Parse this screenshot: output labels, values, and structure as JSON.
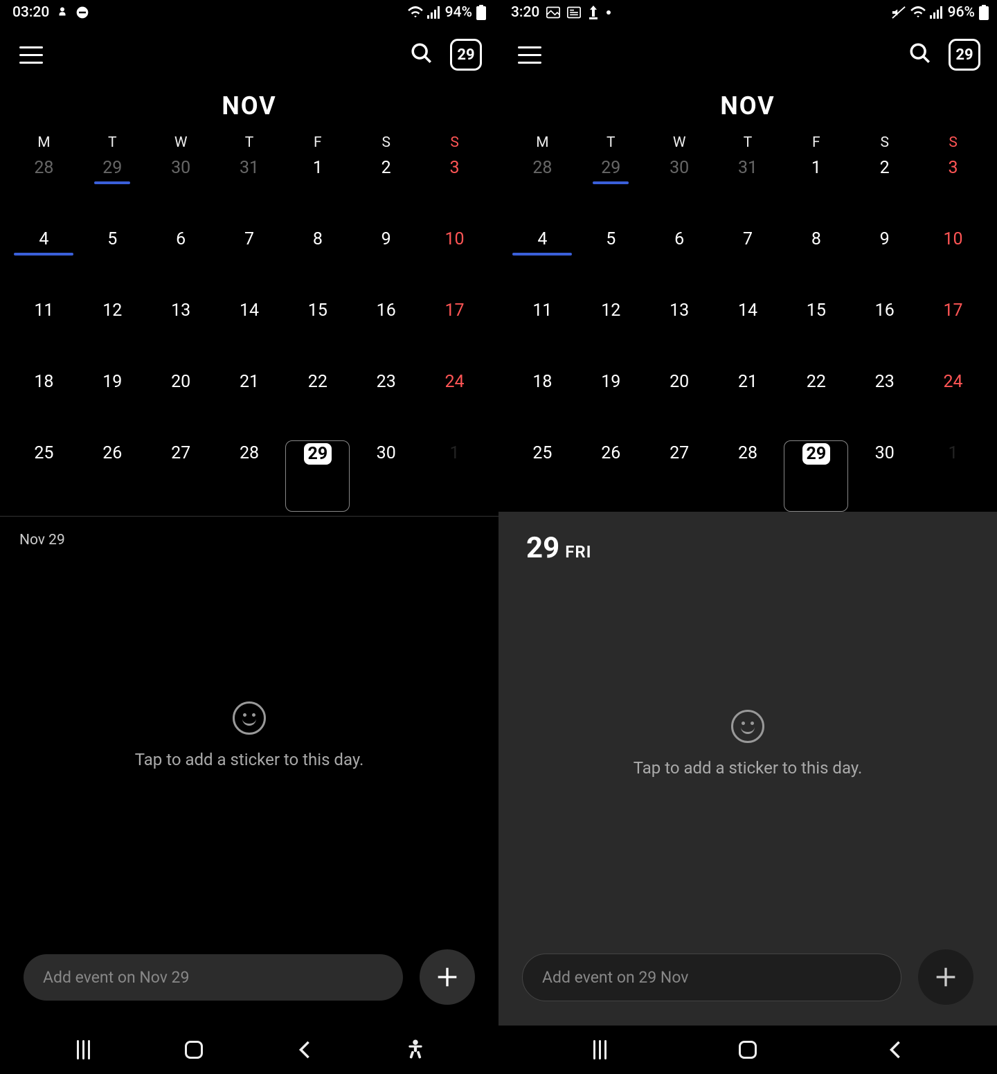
{
  "left": {
    "status": {
      "time": "03:20",
      "battery": "94%"
    },
    "appbar": {
      "today_badge": "29"
    },
    "month": "NOV",
    "weekdays": [
      "M",
      "T",
      "W",
      "T",
      "F",
      "S",
      "S"
    ],
    "rows": [
      [
        {
          "d": "28",
          "cls": "other-month"
        },
        {
          "d": "29",
          "cls": "other-month",
          "underline": true
        },
        {
          "d": "30",
          "cls": "other-month"
        },
        {
          "d": "31",
          "cls": "other-month"
        },
        {
          "d": "1"
        },
        {
          "d": "2"
        },
        {
          "d": "3",
          "cls": "sunday"
        }
      ],
      [
        {
          "d": "4",
          "underline": true,
          "underlineWide": true
        },
        {
          "d": "5"
        },
        {
          "d": "6"
        },
        {
          "d": "7"
        },
        {
          "d": "8"
        },
        {
          "d": "9"
        },
        {
          "d": "10",
          "cls": "sunday"
        }
      ],
      [
        {
          "d": "11"
        },
        {
          "d": "12"
        },
        {
          "d": "13"
        },
        {
          "d": "14"
        },
        {
          "d": "15"
        },
        {
          "d": "16"
        },
        {
          "d": "17",
          "cls": "sunday"
        }
      ],
      [
        {
          "d": "18"
        },
        {
          "d": "19"
        },
        {
          "d": "20"
        },
        {
          "d": "21"
        },
        {
          "d": "22"
        },
        {
          "d": "23"
        },
        {
          "d": "24",
          "cls": "sunday"
        }
      ],
      [
        {
          "d": "25"
        },
        {
          "d": "26"
        },
        {
          "d": "27"
        },
        {
          "d": "28"
        },
        {
          "d": "29",
          "today": true,
          "selected": true
        },
        {
          "d": "30"
        },
        {
          "d": "1",
          "cls": "dim-next"
        }
      ]
    ],
    "panel": {
      "date_small": "Nov 29",
      "sticker_hint": "Tap to add a sticker to this day.",
      "input_placeholder": "Add event on Nov 29"
    }
  },
  "right": {
    "status": {
      "time": "3:20",
      "battery": "96%"
    },
    "appbar": {
      "today_badge": "29"
    },
    "month": "NOV",
    "weekdays": [
      "M",
      "T",
      "W",
      "T",
      "F",
      "S",
      "S"
    ],
    "rows": [
      [
        {
          "d": "28",
          "cls": "other-month"
        },
        {
          "d": "29",
          "cls": "other-month",
          "underline": true
        },
        {
          "d": "30",
          "cls": "other-month"
        },
        {
          "d": "31",
          "cls": "other-month"
        },
        {
          "d": "1"
        },
        {
          "d": "2"
        },
        {
          "d": "3",
          "cls": "sunday"
        }
      ],
      [
        {
          "d": "4",
          "underline": true,
          "underlineWide": true
        },
        {
          "d": "5"
        },
        {
          "d": "6"
        },
        {
          "d": "7"
        },
        {
          "d": "8"
        },
        {
          "d": "9"
        },
        {
          "d": "10",
          "cls": "sunday"
        }
      ],
      [
        {
          "d": "11"
        },
        {
          "d": "12"
        },
        {
          "d": "13"
        },
        {
          "d": "14"
        },
        {
          "d": "15"
        },
        {
          "d": "16"
        },
        {
          "d": "17",
          "cls": "sunday"
        }
      ],
      [
        {
          "d": "18"
        },
        {
          "d": "19"
        },
        {
          "d": "20"
        },
        {
          "d": "21"
        },
        {
          "d": "22"
        },
        {
          "d": "23"
        },
        {
          "d": "24",
          "cls": "sunday"
        }
      ],
      [
        {
          "d": "25"
        },
        {
          "d": "26"
        },
        {
          "d": "27"
        },
        {
          "d": "28"
        },
        {
          "d": "29",
          "today": true,
          "selected": true
        },
        {
          "d": "30"
        },
        {
          "d": "1",
          "cls": "dim-next"
        }
      ]
    ],
    "panel": {
      "date_num": "29",
      "date_day": "FRI",
      "sticker_hint": "Tap to add a sticker to this day.",
      "input_placeholder": "Add event on 29 Nov"
    }
  }
}
